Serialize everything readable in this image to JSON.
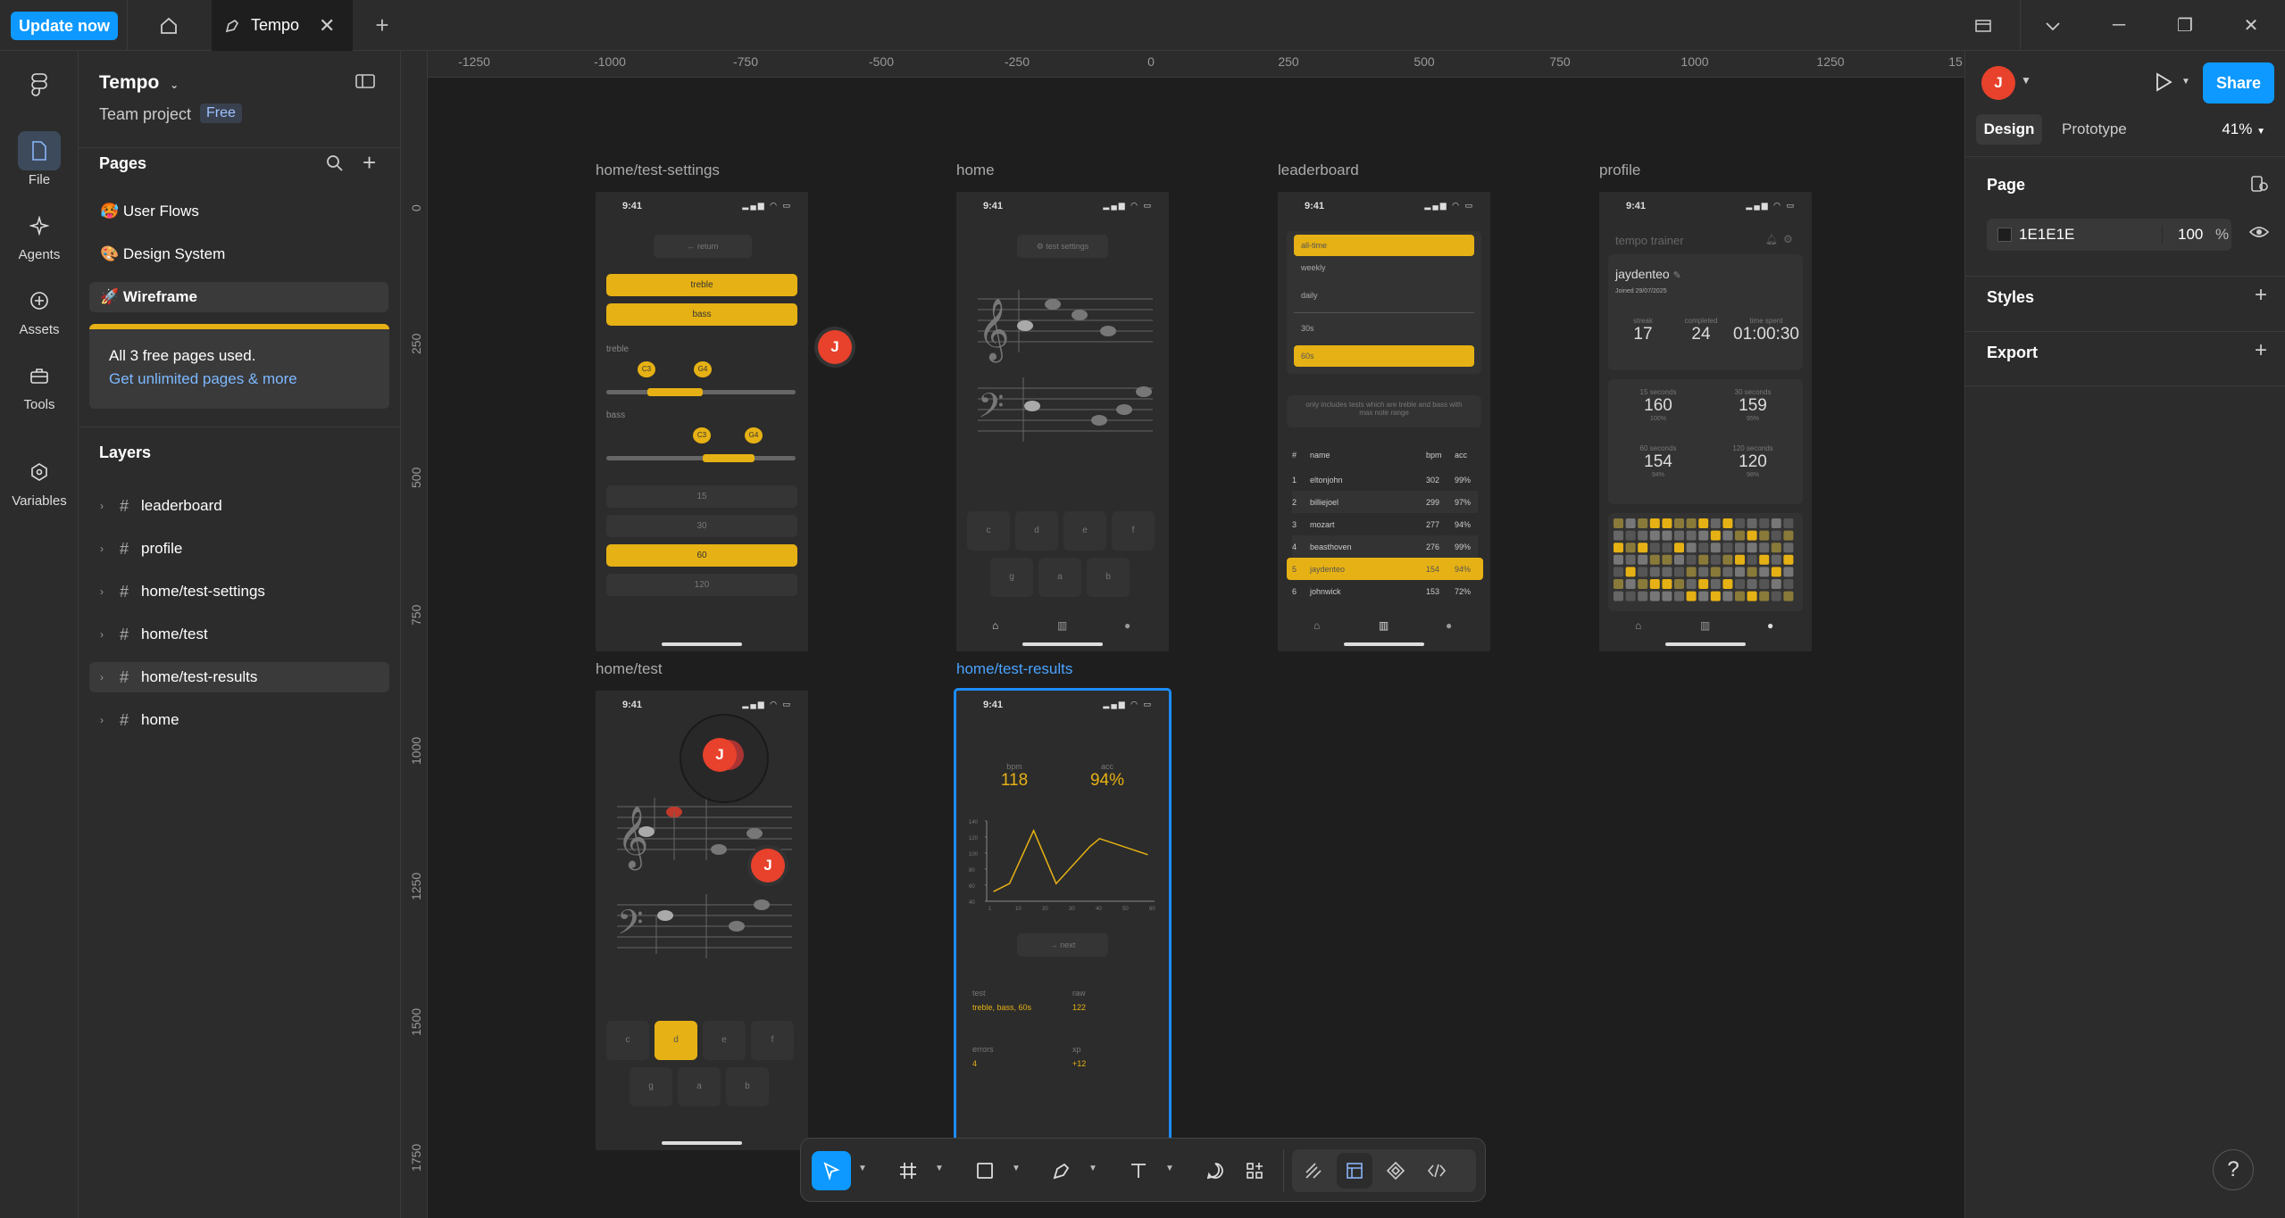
{
  "topbar": {
    "update_label": "Update now",
    "file_tab_label": "Tempo"
  },
  "rail": [
    {
      "label": "File",
      "icon": "file-icon"
    },
    {
      "label": "Agents",
      "icon": "sparkle-icon"
    },
    {
      "label": "Assets",
      "icon": "assets-icon"
    },
    {
      "label": "Tools",
      "icon": "toolbox-icon"
    },
    {
      "label": "Variables",
      "icon": "variables-icon"
    }
  ],
  "project": {
    "name": "Tempo",
    "team": "Team project",
    "plan": "Free"
  },
  "pages": {
    "heading": "Pages",
    "items": [
      {
        "emoji": "🥵",
        "label": "User Flows"
      },
      {
        "emoji": "🎨",
        "label": "Design System"
      },
      {
        "emoji": "🚀",
        "label": "Wireframe"
      }
    ]
  },
  "upsell": {
    "line1": "All 3 free pages used.",
    "line2": "Get unlimited pages & more"
  },
  "layers": {
    "heading": "Layers",
    "items": [
      "leaderboard",
      "profile",
      "home/test-settings",
      "home/test",
      "home/test-results",
      "home"
    ]
  },
  "ruler": {
    "h": [
      "-1250",
      "-1000",
      "-750",
      "-500",
      "-250",
      "0",
      "250",
      "500",
      "750",
      "1000",
      "1250",
      "15"
    ],
    "v": [
      "0",
      "250",
      "500",
      "750",
      "1000",
      "1250",
      "1500",
      "1750"
    ]
  },
  "frames": {
    "settings": {
      "label": "home/test-settings",
      "time": "9:41",
      "return": "return",
      "btn_treble": "treble",
      "btn_bass": "bass",
      "lbl_treble": "treble",
      "lbl_bass": "bass",
      "treble_lo": "C3",
      "treble_hi": "G4",
      "bass_lo": "C3",
      "bass_hi": "G4",
      "opt15": "15",
      "opt30": "30",
      "opt60": "60",
      "opt120": "120"
    },
    "home": {
      "label": "home",
      "time": "9:41",
      "settings_btn": "test settings",
      "keys_row1": [
        "c",
        "d",
        "e",
        "f"
      ],
      "keys_row2": [
        "g",
        "a",
        "b"
      ]
    },
    "leaderboard": {
      "label": "leaderboard",
      "time": "9:41",
      "filters": [
        "all-time",
        "weekly",
        "daily",
        "30s",
        "60s"
      ],
      "note": "only includes tests which are treble and bass with max note range",
      "headers": [
        "#",
        "name",
        "bpm",
        "acc"
      ],
      "rows": [
        [
          "1",
          "eltonjohn",
          "302",
          "99%"
        ],
        [
          "2",
          "billiejoel",
          "299",
          "97%"
        ],
        [
          "3",
          "mozart",
          "277",
          "94%"
        ],
        [
          "4",
          "beasthoven",
          "276",
          "99%"
        ],
        [
          "5",
          "jaydenteo",
          "154",
          "94%"
        ],
        [
          "6",
          "johnwick",
          "153",
          "72%"
        ]
      ]
    },
    "profile": {
      "label": "profile",
      "time": "9:41",
      "app": "tempo trainer",
      "user": "jaydenteo",
      "joined": "Joined 29/07/2025",
      "streak_l": "streak",
      "streak": "17",
      "completed_l": "completed",
      "completed": "24",
      "spent_l": "time spent",
      "spent": "01:00:30",
      "s15_l": "15 seconds",
      "s15": "160",
      "s15_p": "100%",
      "s30_l": "30 seconds",
      "s30": "159",
      "s30_p": "95%",
      "s60_l": "60 seconds",
      "s60": "154",
      "s60_p": "94%",
      "s120_l": "120 seconds",
      "s120": "120",
      "s120_p": "98%"
    },
    "test": {
      "label": "home/test",
      "time": "9:41",
      "keys_row1": [
        "c",
        "d",
        "e",
        "f"
      ],
      "keys_row2": [
        "g",
        "a",
        "b"
      ]
    },
    "results": {
      "label": "home/test-results",
      "time": "9:41",
      "bpm_l": "bpm",
      "bpm": "118",
      "acc_l": "acc",
      "acc": "94%",
      "y_ticks": [
        "140",
        "120",
        "100",
        "80",
        "60",
        "40"
      ],
      "x_ticks": [
        "1",
        "10",
        "20",
        "30",
        "40",
        "50",
        "60"
      ],
      "next": "next",
      "test_l": "test",
      "test_v": "treble, bass, 60s",
      "raw_l": "raw",
      "raw_v": "122",
      "errors_l": "errors",
      "errors_v": "4",
      "xp_l": "xp",
      "xp_v": "+12"
    }
  },
  "avatar_initial": "J",
  "right": {
    "share": "Share",
    "tab_design": "Design",
    "tab_proto": "Prototype",
    "zoom": "41%",
    "page_title": "Page",
    "fill_hex": "1E1E1E",
    "fill_opacity": "100",
    "fill_pct": "%",
    "styles": "Styles",
    "export": "Export"
  },
  "colors": {
    "accent": "#0d99ff",
    "yellow": "#e6b114",
    "avatar": "#e8412c",
    "canvas": "#1e1e1e"
  }
}
